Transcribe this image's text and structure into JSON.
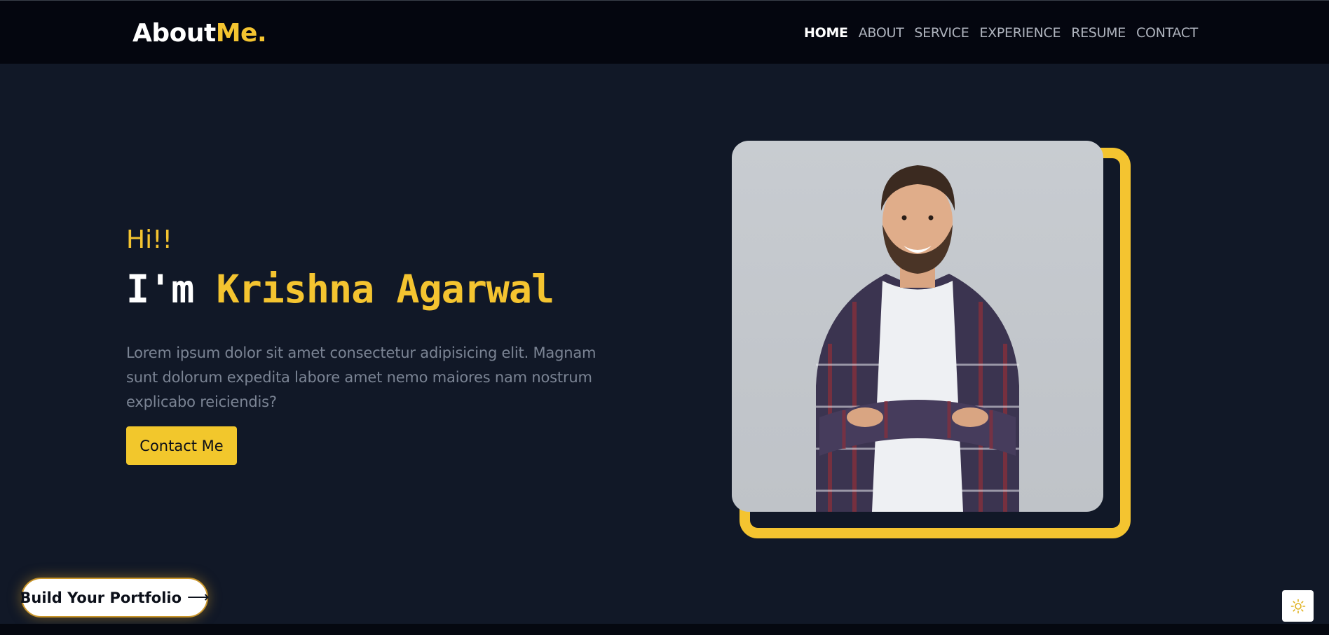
{
  "brand": {
    "logo_main": "About",
    "logo_accent": "Me."
  },
  "nav": {
    "items": [
      {
        "label": "HOME",
        "active": true
      },
      {
        "label": "ABOUT",
        "active": false
      },
      {
        "label": "SERVICE",
        "active": false
      },
      {
        "label": "EXPERIENCE",
        "active": false
      },
      {
        "label": "RESUME",
        "active": false
      },
      {
        "label": "CONTACT",
        "active": false
      }
    ]
  },
  "hero": {
    "greeting": "Hi!!",
    "headline_prefix": "I'm ",
    "headline_name": "Krishna Agarwal",
    "intro": "Lorem ipsum dolor sit amet consectetur adipisicing elit. Magnam sunt dolorum expedita labore amet nemo maiores nam nostrum explicabo reiciendis?",
    "contact_button": "Contact Me",
    "photo_icon": "profile-photo"
  },
  "floating": {
    "build_button": "Build Your Portfolio",
    "build_arrow_icon": "arrow-right-icon",
    "theme_toggle_icon": "sun-icon"
  },
  "colors": {
    "accent": "#f4c430",
    "nav_bg": "#04060f",
    "hero_bg": "#111827",
    "text_muted": "#7b8494"
  }
}
